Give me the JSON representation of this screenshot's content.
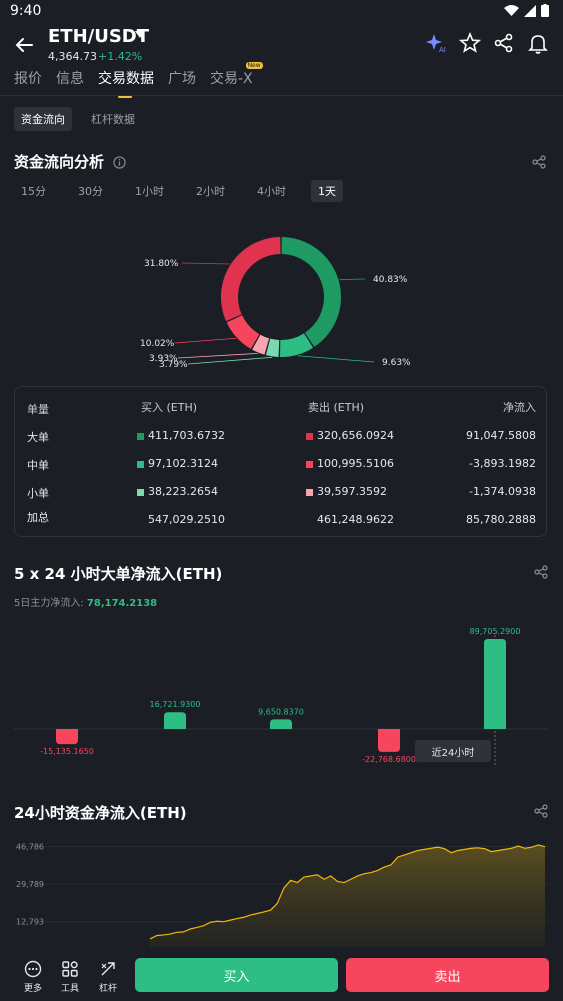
{
  "status": {
    "time": "9:40"
  },
  "header": {
    "pair": "ETH/USDT",
    "price": "4,364.73",
    "change": "+1.42%"
  },
  "tabs": [
    {
      "label": "报价"
    },
    {
      "label": "信息"
    },
    {
      "label": "交易数据"
    },
    {
      "label": "广场"
    },
    {
      "label": "交易-X",
      "badge": "New"
    }
  ],
  "subtabs": [
    {
      "label": "资金流向"
    },
    {
      "label": "杠杆数据"
    }
  ],
  "flow": {
    "title": "资金流向分析",
    "filters": [
      "15分",
      "30分",
      "1小时",
      "2小时",
      "4小时",
      "1天"
    ],
    "donut_labels": {
      "a": "40.83%",
      "b": "9.63%",
      "c": "3.79%",
      "d": "3.93%",
      "e": "10.02%",
      "f": "31.80%"
    },
    "colors": {
      "buy_large": "#1e9a63",
      "buy_mid": "#2ebd85",
      "buy_small": "#7ad9b0",
      "sell_large": "#e0334f",
      "sell_mid": "#f6465d",
      "sell_small": "#f7a4ae"
    },
    "table": {
      "headers": [
        "单量",
        "买入 (ETH)",
        "卖出 (ETH)",
        "净流入"
      ],
      "rows": [
        {
          "label": "大单",
          "buy": "411,703.6732",
          "sell": "320,656.0924",
          "net": "91,047.5808"
        },
        {
          "label": "中单",
          "buy": "97,102.3124",
          "sell": "100,995.5106",
          "net": "-3,893.1982"
        },
        {
          "label": "小单",
          "buy": "38,223.2654",
          "sell": "39,597.3592",
          "net": "-1,374.0938"
        },
        {
          "label": "加总",
          "buy": "547,029.2510",
          "sell": "461,248.9622",
          "net": "85,780.2888"
        }
      ]
    }
  },
  "bigflow": {
    "title": "5 x 24 小时大单净流入(ETH)",
    "summary_label": "5日主力净流入: ",
    "summary_value": "78,174.2138",
    "tooltip": "近24小时"
  },
  "chart_data": [
    {
      "type": "pie",
      "title": "",
      "categories": [
        "40.83%",
        "9.63%",
        "3.79%",
        "3.93%",
        "10.02%",
        "31.80%"
      ],
      "values": [
        40.83,
        9.63,
        3.79,
        3.93,
        10.02,
        31.8
      ]
    },
    {
      "type": "bar",
      "title": "5 x 24 小时大单净流入(ETH)",
      "values": [
        -15135.165,
        16721.93,
        9650.837,
        -22768.68,
        89705.29
      ],
      "labels": [
        "-15,135.1650",
        "16,721.9300",
        "9,650.8370",
        "-22,768.6800",
        "89,705.2900"
      ]
    },
    {
      "type": "area",
      "title": "24小时资金净流入(ETH)",
      "yticks": [
        "46,786",
        "29,789",
        "12,793"
      ],
      "ytick_values": [
        46786,
        29789,
        12793
      ],
      "values": [
        5000,
        6500,
        6800,
        7200,
        8000,
        8200,
        9500,
        10200,
        11000,
        12500,
        13000,
        12800,
        13500,
        14200,
        14800,
        15800,
        16500,
        17200,
        18000,
        21000,
        28000,
        31500,
        30500,
        33000,
        33500,
        34000,
        32000,
        33500,
        31000,
        30500,
        32000,
        33500,
        34500,
        35000,
        36000,
        37500,
        38500,
        42000,
        43000,
        44000,
        45000,
        45500,
        46000,
        46500,
        45800,
        44000,
        45000,
        45500,
        46000,
        46200,
        45800,
        44500,
        45000,
        45500,
        46000,
        47000,
        46000,
        46500,
        47500,
        46700
      ],
      "ylim": [
        0,
        52000
      ],
      "line_color": "#f0b90b"
    }
  ],
  "netflow24": {
    "title": "24小时资金净流入(ETH)"
  },
  "bottom": {
    "more": "更多",
    "tools": "工具",
    "leverage": "杠杆",
    "buy": "买入",
    "sell": "卖出"
  }
}
